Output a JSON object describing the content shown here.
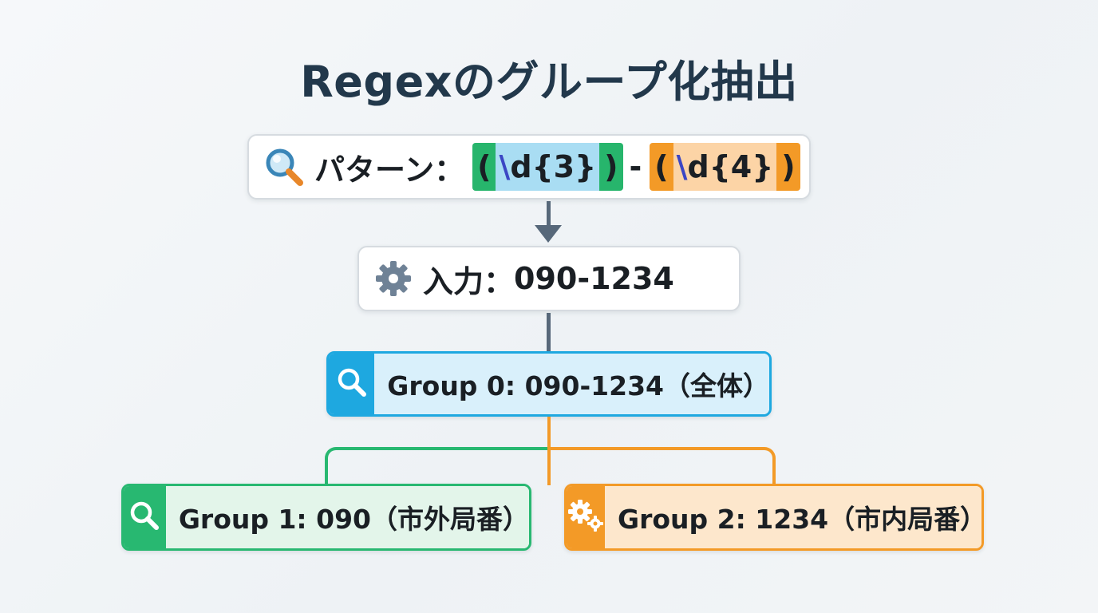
{
  "title": "Regexのグループ化抽出",
  "pattern": {
    "label": "パターン：",
    "group1": {
      "open": "(",
      "escape": "\\",
      "body": "d{3}",
      "close": ")"
    },
    "separator": "-",
    "group2": {
      "open": "(",
      "escape": "\\",
      "body": "d{4}",
      "close": ")"
    }
  },
  "input": {
    "label": "入力：",
    "value": "090-1234"
  },
  "groups": [
    {
      "text": "Group 0: 090-1234（全体）",
      "icon": "search-icon",
      "color": "#1ea8e0"
    },
    {
      "text": "Group 1: 090（市外局番）",
      "icon": "search-icon",
      "color": "#28b871"
    },
    {
      "text": "Group 2: 1234（市内局番）",
      "icon": "gear-icon",
      "color": "#f39a27"
    }
  ],
  "colors": {
    "title": "#22384b",
    "connector": "#57687a",
    "green": "#28b871",
    "orange": "#f39a27",
    "blue": "#1ea8e0"
  }
}
